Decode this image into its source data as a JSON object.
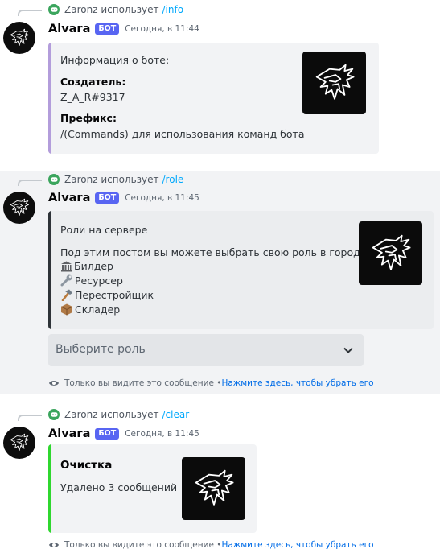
{
  "bot": {
    "name": "Alvara",
    "badge": "БОТ"
  },
  "messages": [
    {
      "reply": {
        "user": "Zaronz",
        "verb": "использует",
        "command": "/info"
      },
      "timestamp": "Сегодня, в 11:44",
      "embed": {
        "accent": "#b39ddb",
        "title": "Информация о боте:",
        "fields": [
          {
            "name": "Создатель:",
            "value": "Z_A_R#9317"
          },
          {
            "name": "Префикс:",
            "value": "/(Commands) для использования команд бота"
          }
        ]
      }
    },
    {
      "reply": {
        "user": "Zaronz",
        "verb": "использует",
        "command": "/role"
      },
      "timestamp": "Сегодня, в 11:45",
      "embed": {
        "accent": "#2e3338",
        "title": "Роли на сервере",
        "description": "Под этим постом вы можете выбрать свою роль в городе:",
        "roles": [
          {
            "icon": "bank-icon",
            "label": "Билдер"
          },
          {
            "icon": "wrench-icon",
            "label": "Ресурсер"
          },
          {
            "icon": "hammer-icon",
            "label": "Перестройщик"
          },
          {
            "icon": "package-icon",
            "label": "Складер"
          }
        ]
      },
      "select": {
        "placeholder": "Выберите роль"
      },
      "ephemeral": {
        "text": "Только вы видите это сообщение • ",
        "link": "Нажмите здесь, чтобы убрать его"
      }
    },
    {
      "reply": {
        "user": "Zaronz",
        "verb": "использует",
        "command": "/clear"
      },
      "timestamp": "Сегодня, в 11:45",
      "embed": {
        "accent": "#2fd72f",
        "title": "Очистка",
        "description": "Удалено 3 сообщений"
      },
      "ephemeral": {
        "text": "Только вы видите это сообщение • ",
        "link": "Нажмите здесь, чтобы убрать его"
      }
    }
  ],
  "icons": {
    "app": "discord-icon",
    "avatar": "glowing-dragon-logo",
    "select": "chevron-down-icon",
    "ephemeral": "eye-icon"
  },
  "colors": {
    "badge": "#5865f2",
    "command": "#00a8fc",
    "link": "#006ce7",
    "highlight": "#f2f3f5"
  }
}
